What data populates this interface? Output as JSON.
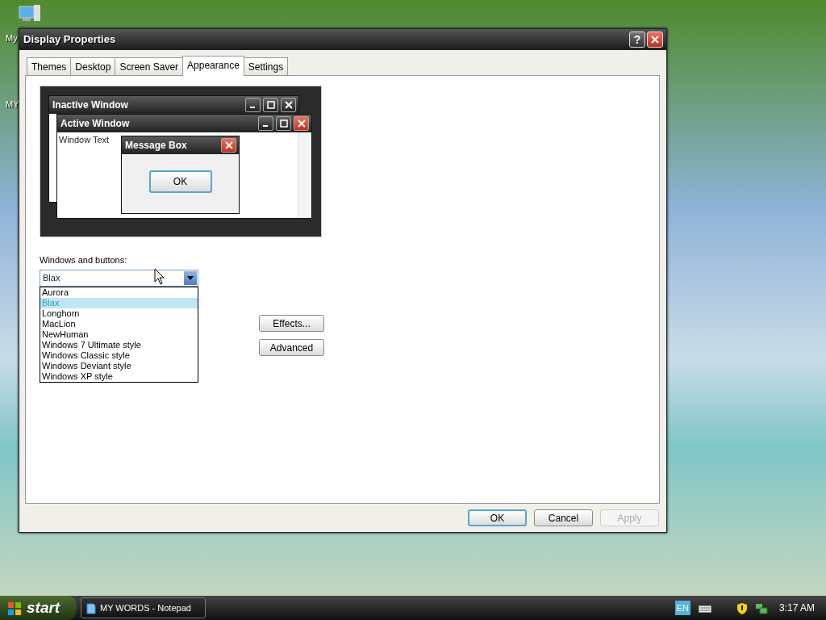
{
  "desktop": {
    "icons": [
      {
        "label": "My"
      },
      {
        "label": "MY"
      }
    ]
  },
  "window": {
    "title": "Display Properties",
    "help": "?"
  },
  "tabs": [
    {
      "label": "Themes",
      "selected": false
    },
    {
      "label": "Desktop",
      "selected": false
    },
    {
      "label": "Screen Saver",
      "selected": false
    },
    {
      "label": "Appearance",
      "selected": true
    },
    {
      "label": "Settings",
      "selected": false
    }
  ],
  "preview": {
    "inactive_title": "Inactive Window",
    "active_title": "Active Window",
    "window_text": "Window Text",
    "message_title": "Message Box",
    "message_button": "OK"
  },
  "windows_and_buttons": {
    "label": "Windows and buttons:",
    "value": "Blax",
    "expanded": true,
    "options": [
      {
        "label": "Aurora",
        "selected": false
      },
      {
        "label": "Blax",
        "selected": true
      },
      {
        "label": "Longhorn",
        "selected": false
      },
      {
        "label": "MacLion",
        "selected": false
      },
      {
        "label": "NewHuman",
        "selected": false
      },
      {
        "label": "Windows 7 Ultimate style",
        "selected": false
      },
      {
        "label": "Windows Classic style",
        "selected": false
      },
      {
        "label": "Windows Deviant style",
        "selected": false
      },
      {
        "label": "Windows XP style",
        "selected": false
      }
    ]
  },
  "side_buttons": [
    "Effects...",
    "Advanced"
  ],
  "buttons": [
    {
      "label": "OK",
      "default": true,
      "disabled": false
    },
    {
      "label": "Cancel",
      "default": false,
      "disabled": false
    },
    {
      "label": "Apply",
      "default": false,
      "disabled": true
    }
  ],
  "taskbar": {
    "start": "start",
    "tasks": [
      "MY WORDS - Notepad"
    ],
    "language": "EN",
    "time": "3:17 AM"
  }
}
